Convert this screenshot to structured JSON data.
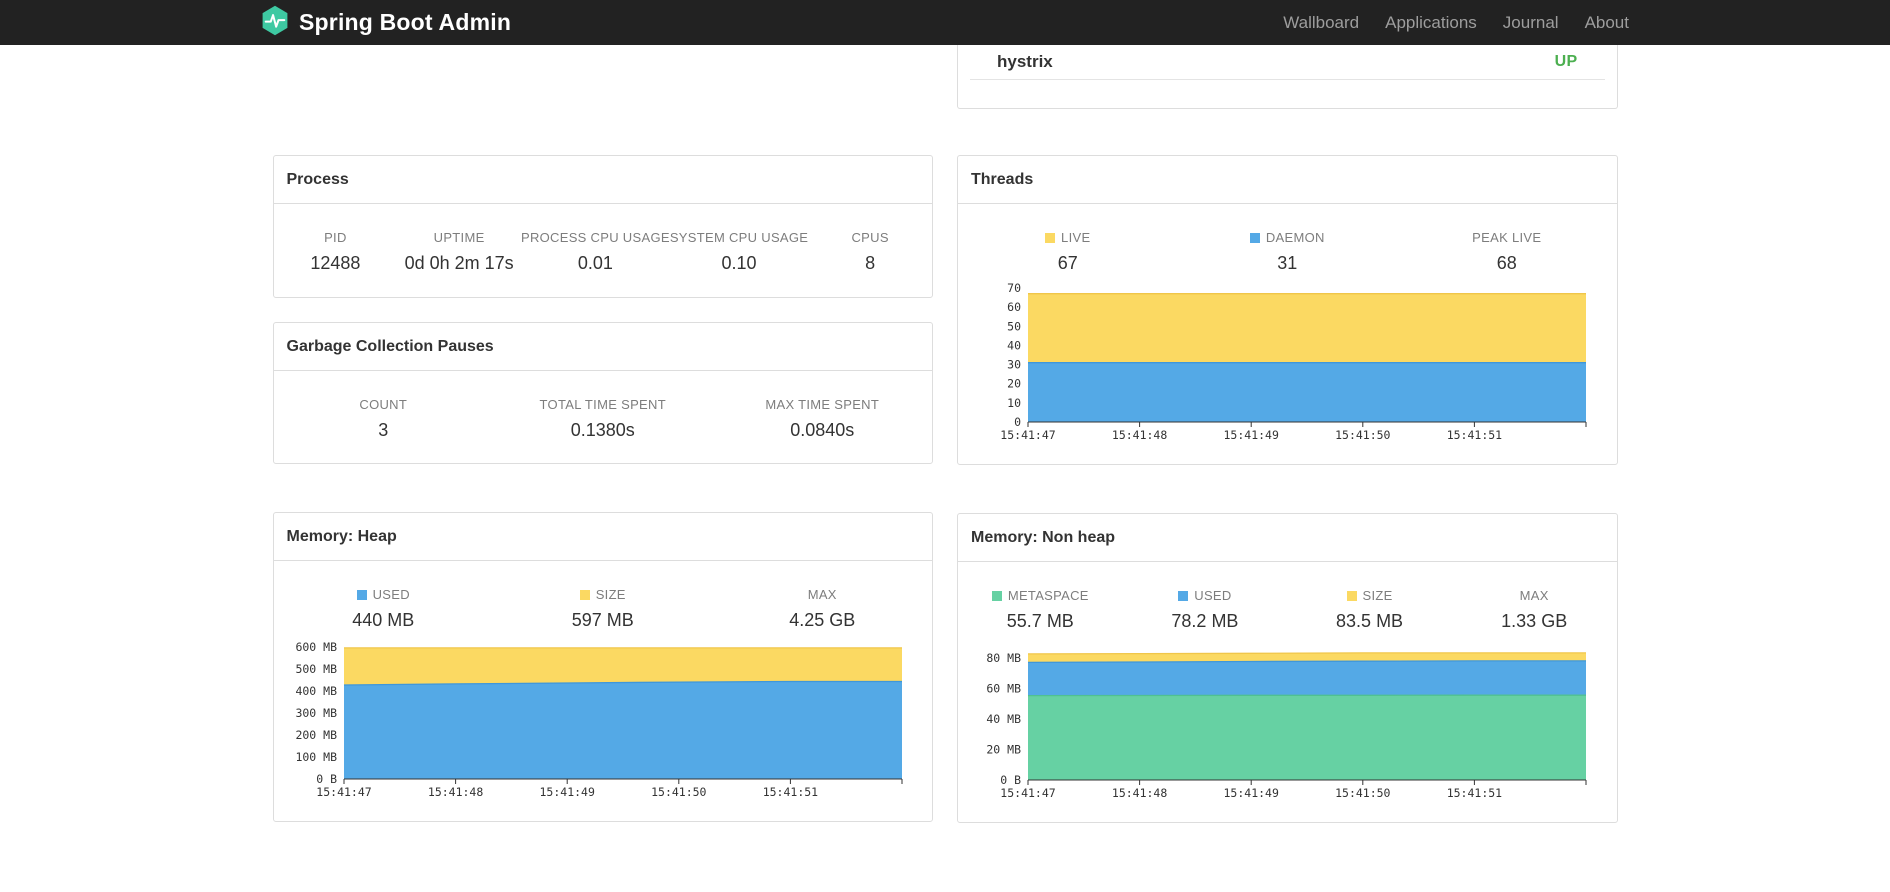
{
  "navbar": {
    "brand": "Spring Boot Admin",
    "items": [
      {
        "label": "Wallboard"
      },
      {
        "label": "Applications"
      },
      {
        "label": "Journal"
      },
      {
        "label": "About"
      }
    ]
  },
  "hystrix_panel": {
    "name": "hystrix",
    "status": "UP",
    "status_color": "#4caf50"
  },
  "process": {
    "title": "Process",
    "metrics": [
      {
        "label": "PID",
        "value": "12488"
      },
      {
        "label": "UPTIME",
        "value": "0d 0h 2m 17s"
      },
      {
        "label": "PROCESS CPU USAGE",
        "value": "0.01"
      },
      {
        "label": "SYSTEM CPU USAGE",
        "value": "0.10"
      },
      {
        "label": "CPUS",
        "value": "8"
      }
    ]
  },
  "gc": {
    "title": "Garbage Collection Pauses",
    "metrics": [
      {
        "label": "COUNT",
        "value": "3"
      },
      {
        "label": "TOTAL TIME SPENT",
        "value": "0.1380s"
      },
      {
        "label": "MAX TIME SPENT",
        "value": "0.0840s"
      }
    ]
  },
  "threads": {
    "title": "Threads",
    "legend": [
      {
        "label": "LIVE",
        "value": "67",
        "swatch": "#fbd962"
      },
      {
        "label": "DAEMON",
        "value": "31",
        "swatch": "#54a9e6"
      },
      {
        "label": "PEAK LIVE",
        "value": "68"
      }
    ]
  },
  "heap": {
    "title": "Memory: Heap",
    "legend": [
      {
        "label": "USED",
        "value": "440 MB",
        "swatch": "#54a9e6"
      },
      {
        "label": "SIZE",
        "value": "597 MB",
        "swatch": "#fbd962"
      },
      {
        "label": "MAX",
        "value": "4.25 GB"
      }
    ]
  },
  "nonheap": {
    "title": "Memory: Non heap",
    "legend": [
      {
        "label": "METASPACE",
        "value": "55.7 MB",
        "swatch": "#66d1a3"
      },
      {
        "label": "USED",
        "value": "78.2 MB",
        "swatch": "#54a9e6"
      },
      {
        "label": "SIZE",
        "value": "83.5 MB",
        "swatch": "#fbd962"
      },
      {
        "label": "MAX",
        "value": "1.33 GB"
      }
    ]
  },
  "brand_color": "#3ec9a2",
  "chart_data": [
    {
      "id": "threads",
      "type": "area",
      "title": "Threads",
      "x": [
        "15:41:47",
        "15:41:48",
        "15:41:49",
        "15:41:50",
        "15:41:51"
      ],
      "series": [
        {
          "name": "LIVE",
          "color": "#fbd962",
          "line": "#f0c64a",
          "values": [
            67,
            67,
            67,
            67,
            67
          ]
        },
        {
          "name": "DAEMON",
          "color": "#54a9e6",
          "line": "#3f97da",
          "values": [
            31,
            31,
            31,
            31,
            31
          ]
        }
      ],
      "peak_live": 68,
      "ylim": [
        0,
        70
      ],
      "yticks": [
        0,
        10,
        20,
        30,
        40,
        50,
        60,
        70
      ],
      "ytick_labels": [
        "0",
        "10",
        "20",
        "30",
        "40",
        "50",
        "60",
        "70"
      ],
      "grid": false,
      "legend_position": "top"
    },
    {
      "id": "memory-heap",
      "type": "area",
      "title": "Memory: Heap",
      "x": [
        "15:41:47",
        "15:41:48",
        "15:41:49",
        "15:41:50",
        "15:41:51"
      ],
      "series": [
        {
          "name": "SIZE",
          "color": "#fbd962",
          "line": "#f0c64a",
          "values": [
            597,
            597,
            597,
            597,
            597
          ]
        },
        {
          "name": "USED",
          "color": "#54a9e6",
          "line": "#3f97da",
          "values": [
            428,
            433,
            437,
            441,
            444
          ]
        }
      ],
      "max": "4.25 GB",
      "ylim": [
        0,
        610
      ],
      "yticks": [
        0,
        100,
        200,
        300,
        400,
        500,
        600
      ],
      "ytick_labels": [
        "0 B",
        "100 MB",
        "200 MB",
        "300 MB",
        "400 MB",
        "500 MB",
        "600 MB"
      ],
      "grid": false,
      "legend_position": "top"
    },
    {
      "id": "memory-nonheap",
      "type": "area",
      "title": "Memory: Non heap",
      "x": [
        "15:41:47",
        "15:41:48",
        "15:41:49",
        "15:41:50",
        "15:41:51"
      ],
      "series": [
        {
          "name": "SIZE",
          "color": "#fbd962",
          "line": "#f0c64a",
          "values": [
            82.8,
            83.0,
            83.2,
            83.5,
            83.5
          ]
        },
        {
          "name": "USED",
          "color": "#54a9e6",
          "line": "#3f97da",
          "values": [
            77.2,
            77.5,
            77.8,
            78.0,
            78.2
          ]
        },
        {
          "name": "METASPACE",
          "color": "#66d1a3",
          "line": "#4fc191",
          "values": [
            55.4,
            55.5,
            55.6,
            55.6,
            55.7
          ]
        }
      ],
      "max": "1.33 GB",
      "ylim": [
        0,
        88
      ],
      "yticks": [
        0,
        20,
        40,
        60,
        80
      ],
      "ytick_labels": [
        "0 B",
        "20 MB",
        "40 MB",
        "60 MB",
        "80 MB"
      ],
      "grid": false,
      "legend_position": "top"
    }
  ]
}
